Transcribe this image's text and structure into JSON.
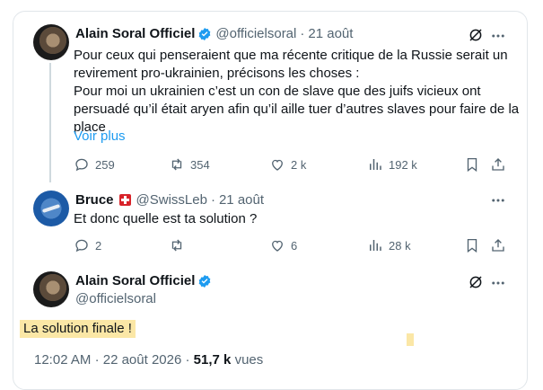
{
  "tweet1": {
    "author_name": "Alain Soral Officiel",
    "handle": "@officielsoral",
    "separator": "·",
    "date": "21 août",
    "text": "Pour ceux qui penseraient que ma récente critique de la Russie serait un\nrevirement pro-ukrainien, précisons les choses :\nPour moi un ukrainien c’est un con de slave que des juifs vicieux ont\npersuadé qu’il était aryen afin qu’il aille tuer d’autres slaves pour faire de la\nplace",
    "show_more": "Voir plus",
    "replies": "259",
    "reposts": "354",
    "likes": "2 k",
    "views": "192 k"
  },
  "tweet2": {
    "author_name": "Bruce",
    "handle": "@SwissLeb",
    "separator": "·",
    "date": "21 août",
    "text": "Et donc quelle est ta solution ?",
    "replies": "2",
    "reposts": "",
    "likes": "6",
    "views": "28 k"
  },
  "tweet3": {
    "author_name": "Alain Soral Officiel",
    "handle": "@officielsoral",
    "text": "La solution finale !",
    "time": "12:02 AM",
    "separator": "·",
    "date": "22 août 2026",
    "views_count": "51,7 k",
    "views_label": "vues"
  },
  "icons": {
    "verified": "verified-badge-icon",
    "grok": "grok-icon",
    "more": "more-icon",
    "reply": "reply-icon",
    "repost": "repost-icon",
    "like": "like-icon",
    "views": "views-icon",
    "bookmark": "bookmark-icon",
    "share": "share-icon",
    "flag": "swiss-flag-icon"
  },
  "colors": {
    "accent": "#1d9bf0",
    "secondary_text": "#536471",
    "highlight": "#fbe7a6"
  }
}
